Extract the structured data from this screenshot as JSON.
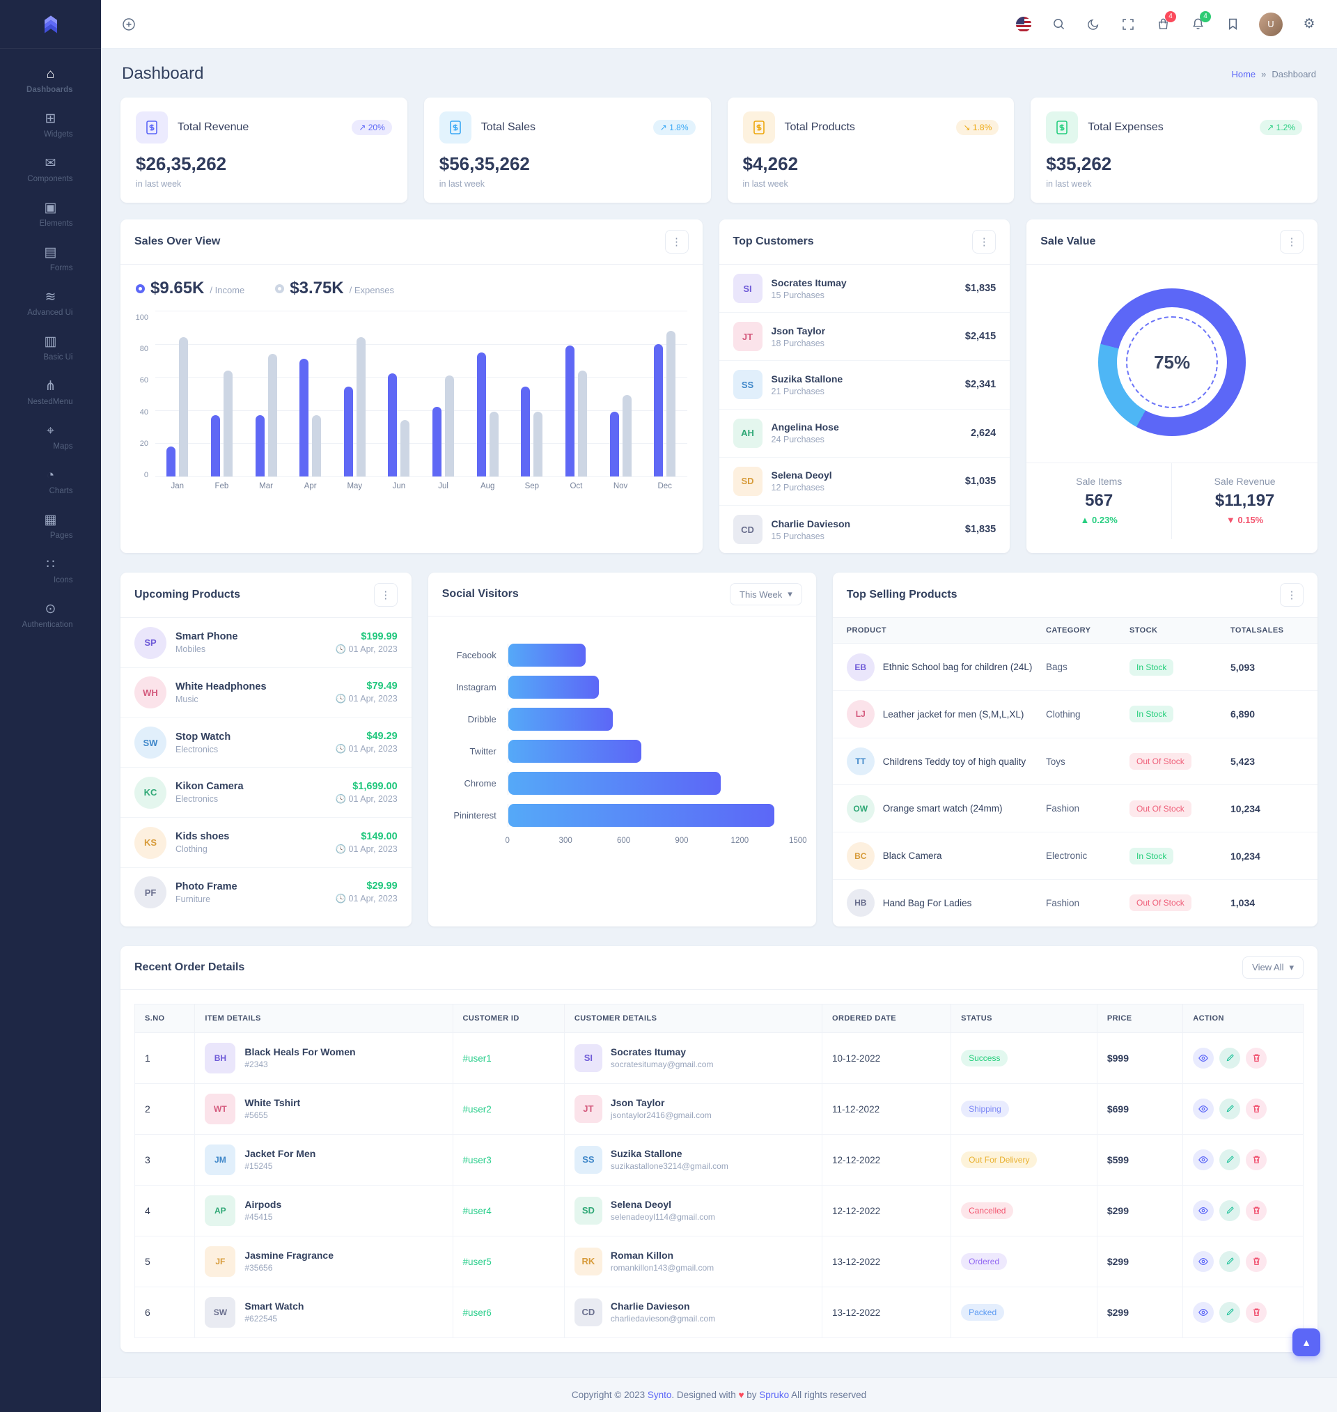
{
  "palette": {
    "primary": "#5C67F7",
    "info": "#4EB6F5",
    "success": "#27CE80",
    "danger": "#F3536D",
    "warning": "#EDA810",
    "sidebar_bg": "#1E2745",
    "page_bg": "#EDF2F8",
    "gray_bar": "#CDD6E4"
  },
  "header": {
    "cart_badge": "4",
    "notification_badge": "4",
    "avatar_initials": "U"
  },
  "sidebar": {
    "items": [
      {
        "label": "Dashboards",
        "glyph": "⌂",
        "active": true
      },
      {
        "label": "Widgets",
        "glyph": "⊞",
        "active": false
      },
      {
        "label": "Components",
        "glyph": "✉",
        "active": false
      },
      {
        "label": "Elements",
        "glyph": "▣",
        "active": false
      },
      {
        "label": "Forms",
        "glyph": "▤",
        "active": false
      },
      {
        "label": "Advanced Ui",
        "glyph": "≋",
        "active": false
      },
      {
        "label": "Basic Ui",
        "glyph": "▥",
        "active": false
      },
      {
        "label": "NestedMenu",
        "glyph": "⋔",
        "active": false
      },
      {
        "label": "Maps",
        "glyph": "⌖",
        "active": false
      },
      {
        "label": "Charts",
        "glyph": "◔",
        "active": false
      },
      {
        "label": "Pages",
        "glyph": "▦",
        "active": false
      },
      {
        "label": "Icons",
        "glyph": "∷",
        "active": false
      },
      {
        "label": "Authentication",
        "glyph": "⊙",
        "active": false
      }
    ]
  },
  "page": {
    "title": "Dashboard",
    "breadcrumb_home": "Home",
    "breadcrumb_sep": "»",
    "breadcrumb_current": "Dashboard"
  },
  "stats": [
    {
      "title": "Total Revenue",
      "value": "$26,35,262",
      "note": "in last week",
      "arrow": "↗",
      "delta": "20%",
      "scheme": "purple",
      "icon": "revenue-receipt-icon"
    },
    {
      "title": "Total Sales",
      "value": "$56,35,262",
      "note": "in last week",
      "arrow": "↗",
      "delta": "1.8%",
      "scheme": "blue",
      "icon": "sales-receipt-icon"
    },
    {
      "title": "Total Products",
      "value": "$4,262",
      "note": "in last week",
      "arrow": "↘",
      "delta": "1.8%",
      "scheme": "orange",
      "icon": "products-bag-icon"
    },
    {
      "title": "Total Expenses",
      "value": "$35,262",
      "note": "in last week",
      "arrow": "↗",
      "delta": "1.2%",
      "scheme": "green",
      "icon": "expenses-dollar-icon"
    }
  ],
  "sales_overview": {
    "title": "Sales Over View",
    "income_value": "$9.65K",
    "income_label": "/ Income",
    "expenses_value": "$3.75K",
    "expenses_label": "/ Expenses"
  },
  "top_customers": {
    "title": "Top Customers",
    "items": [
      {
        "name": "Socrates Itumay",
        "purchases": "15 Purchases",
        "amount": "$1,835",
        "initials": "SI"
      },
      {
        "name": "Json Taylor",
        "purchases": "18 Purchases",
        "amount": "$2,415",
        "initials": "JT"
      },
      {
        "name": "Suzika Stallone",
        "purchases": "21 Purchases",
        "amount": "$2,341",
        "initials": "SS"
      },
      {
        "name": "Angelina Hose",
        "purchases": "24 Purchases",
        "amount": "2,624",
        "initials": "AH"
      },
      {
        "name": "Selena Deoyl",
        "purchases": "12 Purchases",
        "amount": "$1,035",
        "initials": "SD"
      },
      {
        "name": "Charlie Davieson",
        "purchases": "15 Purchases",
        "amount": "$1,835",
        "initials": "CD"
      }
    ]
  },
  "sale_value": {
    "title": "Sale Value",
    "items_label": "Sale Items",
    "items_value": "567",
    "items_arrow": "▲",
    "items_delta": "0.23%",
    "revenue_label": "Sale Revenue",
    "revenue_value": "$11,197",
    "revenue_arrow": "▼",
    "revenue_delta": "0.15%"
  },
  "upcoming_products": {
    "title": "Upcoming Products",
    "items": [
      {
        "name": "Smart Phone",
        "category": "Mobiles",
        "price": "$199.99",
        "date": "01 Apr, 2023",
        "initials": "SP"
      },
      {
        "name": "White Headphones",
        "category": "Music",
        "price": "$79.49",
        "date": "01 Apr, 2023",
        "initials": "WH"
      },
      {
        "name": "Stop Watch",
        "category": "Electronics",
        "price": "$49.29",
        "date": "01 Apr, 2023",
        "initials": "SW"
      },
      {
        "name": "Kikon Camera",
        "category": "Electronics",
        "price": "$1,699.00",
        "date": "01 Apr, 2023",
        "initials": "KC"
      },
      {
        "name": "Kids shoes",
        "category": "Clothing",
        "price": "$149.00",
        "date": "01 Apr, 2023",
        "initials": "KS"
      },
      {
        "name": "Photo Frame",
        "category": "Furniture",
        "price": "$29.99",
        "date": "01 Apr, 2023",
        "initials": "PF"
      }
    ]
  },
  "social_visitors": {
    "title": "Social Visitors",
    "range_label": "This Week",
    "chevron": "▾"
  },
  "top_selling": {
    "title": "Top Selling Products",
    "columns": [
      "PRODUCT",
      "CATEGORY",
      "STOCK",
      "TOTALSALES"
    ],
    "rows": [
      {
        "product": "Ethnic School bag for children (24L)",
        "category": "Bags",
        "stock": "In Stock",
        "stock_state": "in",
        "sales": "5,093",
        "initials": "EB"
      },
      {
        "product": "Leather jacket for men (S,M,L,XL)",
        "category": "Clothing",
        "stock": "In Stock",
        "stock_state": "in",
        "sales": "6,890",
        "initials": "LJ"
      },
      {
        "product": "Childrens Teddy toy of high quality",
        "category": "Toys",
        "stock": "Out Of Stock",
        "stock_state": "out",
        "sales": "5,423",
        "initials": "TT"
      },
      {
        "product": "Orange smart watch (24mm)",
        "category": "Fashion",
        "stock": "Out Of Stock",
        "stock_state": "out",
        "sales": "10,234",
        "initials": "OW"
      },
      {
        "product": "Black Camera",
        "category": "Electronic",
        "stock": "In Stock",
        "stock_state": "in",
        "sales": "10,234",
        "initials": "BC"
      },
      {
        "product": "Hand Bag For Ladies",
        "category": "Fashion",
        "stock": "Out Of Stock",
        "stock_state": "out",
        "sales": "1,034",
        "initials": "HB"
      }
    ]
  },
  "orders": {
    "title": "Recent Order Details",
    "view_all": "View All",
    "chevron": "▾",
    "columns": [
      "S.NO",
      "ITEM DETAILS",
      "CUSTOMER ID",
      "CUSTOMER DETAILS",
      "ORDERED DATE",
      "STATUS",
      "PRICE",
      "ACTION"
    ],
    "rows": [
      {
        "sno": "1",
        "item": "Black Heals For Women",
        "item_id": "#2343",
        "customer_id": "#user1",
        "customer": "Socrates Itumay",
        "email": "socratesitumay@gmail.com",
        "date": "10-12-2022",
        "status": "Success",
        "status_key": "success",
        "price": "$999",
        "initials": "BH"
      },
      {
        "sno": "2",
        "item": "White Tshirt",
        "item_id": "#5655",
        "customer_id": "#user2",
        "customer": "Json Taylor",
        "email": "jsontaylor2416@gmail.com",
        "date": "11-12-2022",
        "status": "Shipping",
        "status_key": "shipping",
        "price": "$699",
        "initials": "WT"
      },
      {
        "sno": "3",
        "item": "Jacket For Men",
        "item_id": "#15245",
        "customer_id": "#user3",
        "customer": "Suzika Stallone",
        "email": "suzikastallone3214@gmail.com",
        "date": "12-12-2022",
        "status": "Out For Delivery",
        "status_key": "delivery",
        "price": "$599",
        "initials": "JM"
      },
      {
        "sno": "4",
        "item": "Airpods",
        "item_id": "#45415",
        "customer_id": "#user4",
        "customer": "Selena Deoyl",
        "email": "selenadeoyl114@gmail.com",
        "date": "12-12-2022",
        "status": "Cancelled",
        "status_key": "cancelled",
        "price": "$299",
        "initials": "AP"
      },
      {
        "sno": "5",
        "item": "Jasmine Fragrance",
        "item_id": "#35656",
        "customer_id": "#user5",
        "customer": "Roman Killon",
        "email": "romankillon143@gmail.com",
        "date": "13-12-2022",
        "status": "Ordered",
        "status_key": "ordered",
        "price": "$299",
        "initials": "JF"
      },
      {
        "sno": "6",
        "item": "Smart Watch",
        "item_id": "#622545",
        "customer_id": "#user6",
        "customer": "Charlie Davieson",
        "email": "charliedavieson@gmail.com",
        "date": "13-12-2022",
        "status": "Packed",
        "status_key": "packed",
        "price": "$299",
        "initials": "SW"
      }
    ]
  },
  "footer": {
    "prefix": "Copyright © 2023",
    "brand": "Synto",
    "middle": ". Designed with",
    "heart": "♥",
    "by": "by",
    "designer": "Spruko",
    "suffix": "All rights reserved"
  },
  "chart_data": [
    {
      "id": "sales_over_view",
      "type": "bar",
      "title": "Sales Over View",
      "categories": [
        "Jan",
        "Feb",
        "Mar",
        "Apr",
        "May",
        "Jun",
        "Jul",
        "Aug",
        "Sep",
        "Oct",
        "Nov",
        "Dec"
      ],
      "series": [
        {
          "name": "Income",
          "color": "#5F68F5",
          "values": [
            18,
            37,
            37,
            71,
            54,
            62,
            42,
            75,
            54,
            79,
            39,
            80
          ]
        },
        {
          "name": "Expenses",
          "color": "#CDD6E4",
          "values": [
            84,
            64,
            74,
            37,
            84,
            34,
            61,
            39,
            39,
            64,
            49,
            88
          ]
        }
      ],
      "ylim": [
        0,
        100
      ],
      "yticks": [
        100,
        80,
        60,
        40,
        20,
        0
      ],
      "grid": true,
      "legend_position": "top"
    },
    {
      "id": "social_visitors",
      "type": "bar",
      "orientation": "horizontal",
      "title": "Social Visitors",
      "categories": [
        "Facebook",
        "Instagram",
        "Dribble",
        "Twitter",
        "Chrome",
        "Pininterest"
      ],
      "values": [
        400,
        470,
        540,
        690,
        1100,
        1380
      ],
      "xlim": [
        0,
        1500
      ],
      "xticks": [
        0,
        300,
        600,
        900,
        1200,
        1500
      ],
      "bar_gradient": [
        "#55A9F8",
        "#5C67F7"
      ]
    },
    {
      "id": "sale_value",
      "type": "pie",
      "title": "Sale Value",
      "center_label": "75%",
      "slices": [
        {
          "name": "Sale",
          "value": 75,
          "color": "#5C67F7"
        },
        {
          "name": "Remaining",
          "value": 25,
          "color": "#4EB6F5"
        }
      ],
      "gradient_stops": [
        {
          "color": "#5C67F7",
          "from": 0,
          "to": 58
        },
        {
          "color": "#4EB6F5",
          "from": 58,
          "to": 79
        },
        {
          "color": "#5C67F7",
          "from": 79,
          "to": 100
        }
      ]
    }
  ]
}
